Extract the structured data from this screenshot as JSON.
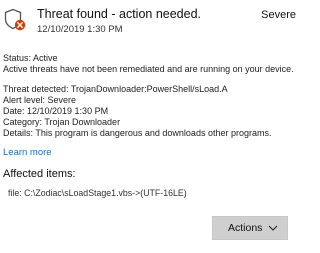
{
  "header": {
    "title": "Threat found - action needed.",
    "severity": "Severe",
    "timestamp": "12/10/2019 1:30 PM",
    "icon": "shield-alert-icon",
    "accent_color": "#d83b01"
  },
  "status": {
    "line1": "Status:  Active",
    "line2": "Active threats have not been remediated and are running on your device."
  },
  "details": {
    "threat": "Threat detected:  TrojanDownloader:PowerShell/sLoad.A",
    "alert_level": "Alert level:  Severe",
    "date": "Date:  12/10/2019 1:30 PM",
    "category": "Category:  Trojan Downloader",
    "description": "Details:  This program is dangerous and downloads other programs."
  },
  "links": {
    "learn_more": "Learn more",
    "link_color": "#1a6fd0"
  },
  "affected": {
    "title": "Affected items:",
    "file": "file: C:\\Zodiac\\sLoadStage1.vbs->(UTF-16LE)"
  },
  "actions": {
    "label": "Actions",
    "icon": "chevron-down-icon"
  }
}
